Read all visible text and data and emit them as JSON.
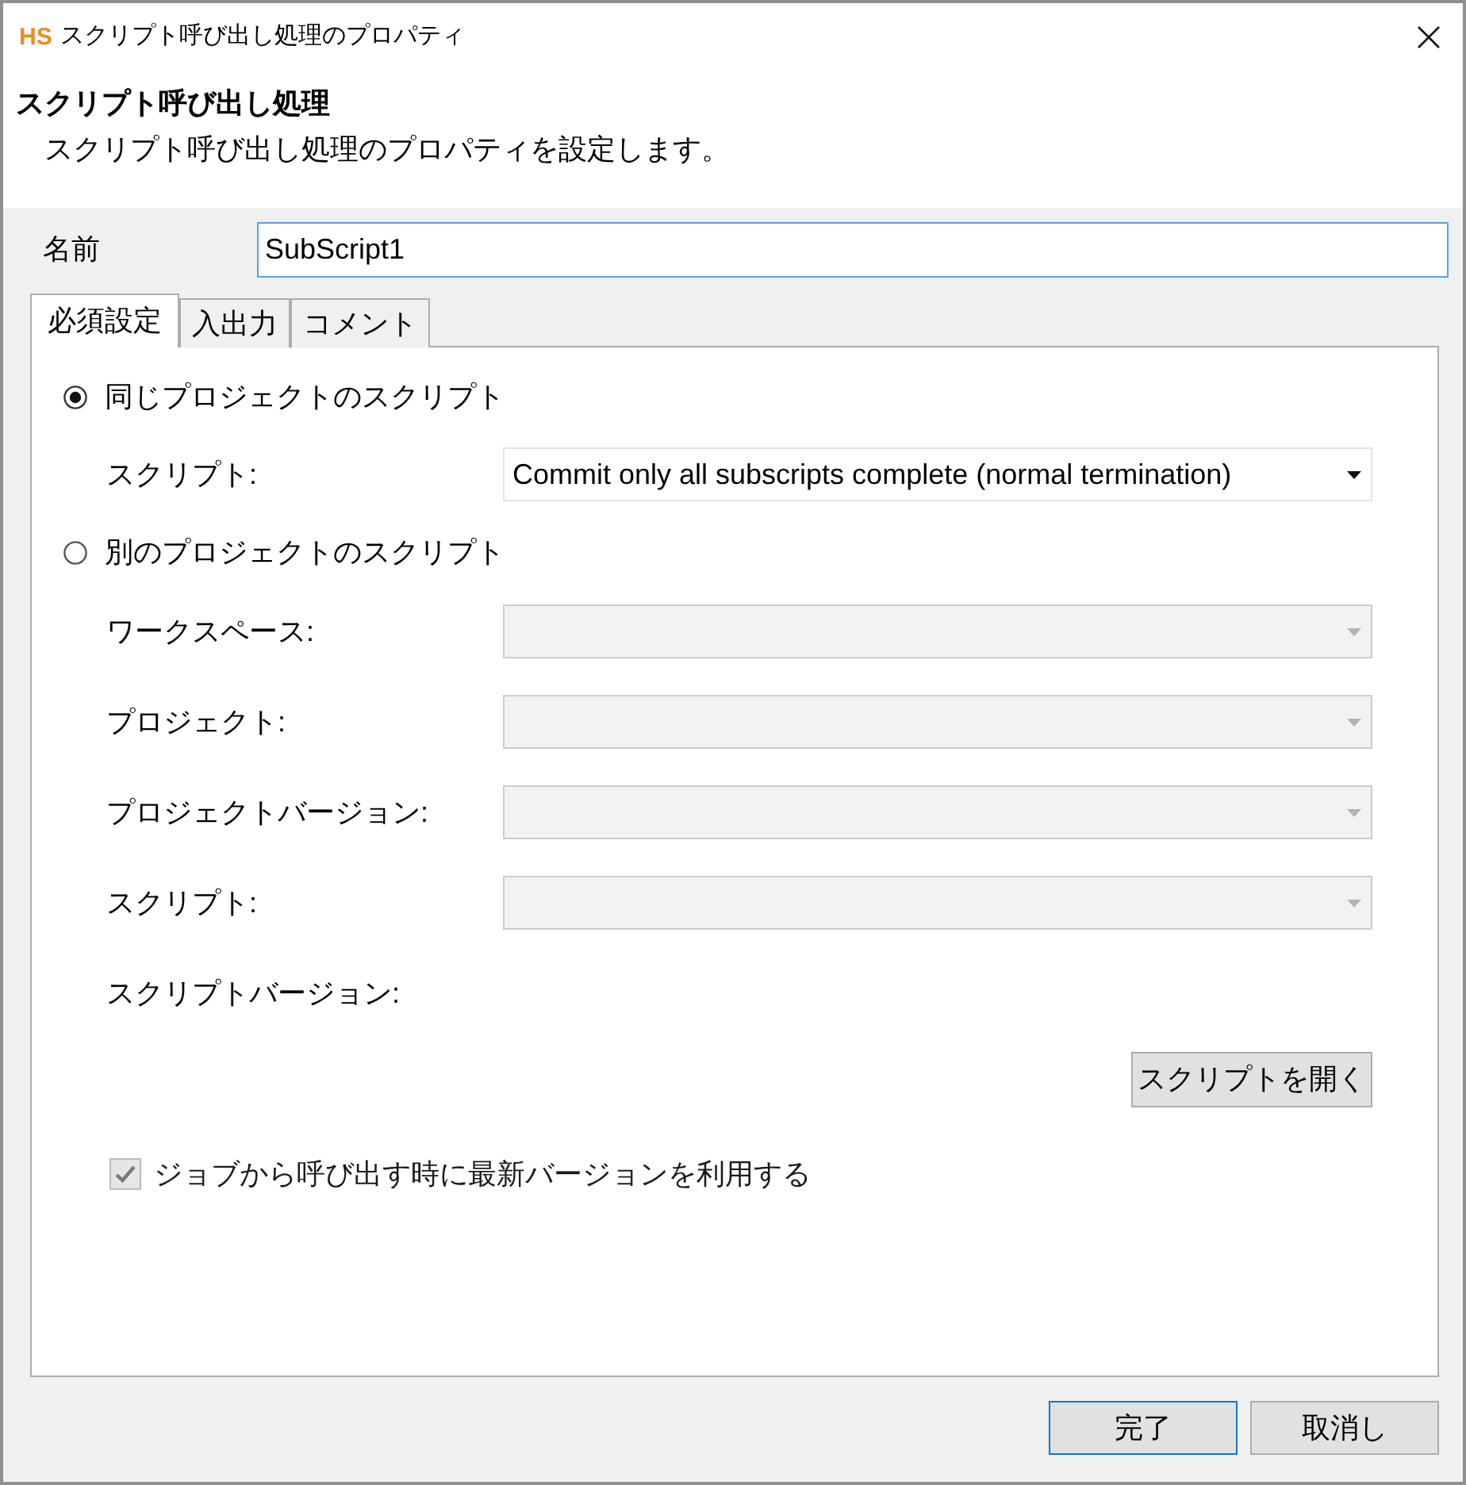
{
  "window": {
    "logo": "HS",
    "title": "スクリプト呼び出し処理のプロパティ"
  },
  "header": {
    "title": "スクリプト呼び出し処理",
    "description": "スクリプト呼び出し処理のプロパティを設定します。"
  },
  "name_field": {
    "label": "名前",
    "value": "SubScript1",
    "focused": true
  },
  "tabs": [
    {
      "label": "必須設定",
      "selected": true
    },
    {
      "label": "入出力",
      "selected": false
    },
    {
      "label": "コメント",
      "selected": false
    }
  ],
  "script_source": [
    {
      "label": "同じプロジェクトのスクリプト",
      "selected": true,
      "fields": [
        {
          "kind": "dropdown",
          "label": "スクリプト:",
          "value": "Commit only all subscripts complete (normal termination)",
          "disabled": false
        }
      ]
    },
    {
      "label": "別のプロジェクトのスクリプト",
      "selected": false,
      "fields": [
        {
          "kind": "dropdown",
          "label": "ワークスペース:",
          "disabled": true
        },
        {
          "kind": "dropdown",
          "label": "プロジェクト:",
          "disabled": true
        },
        {
          "kind": "dropdown",
          "label": "プロジェクトバージョン:",
          "disabled": true
        },
        {
          "kind": "dropdown",
          "label": "スクリプト:",
          "disabled": true
        },
        {
          "kind": "readout",
          "label": "スクリプトバージョン:"
        }
      ]
    }
  ],
  "open_script_button": {
    "label": "スクリプトを開く"
  },
  "latest_version_checkbox": {
    "label": "ジョブから呼び出す時に最新バージョンを利用する",
    "checked": true,
    "disabled": true
  },
  "buttons": [
    {
      "label": "完了",
      "default": true
    },
    {
      "label": "取消し",
      "default": false
    }
  ]
}
